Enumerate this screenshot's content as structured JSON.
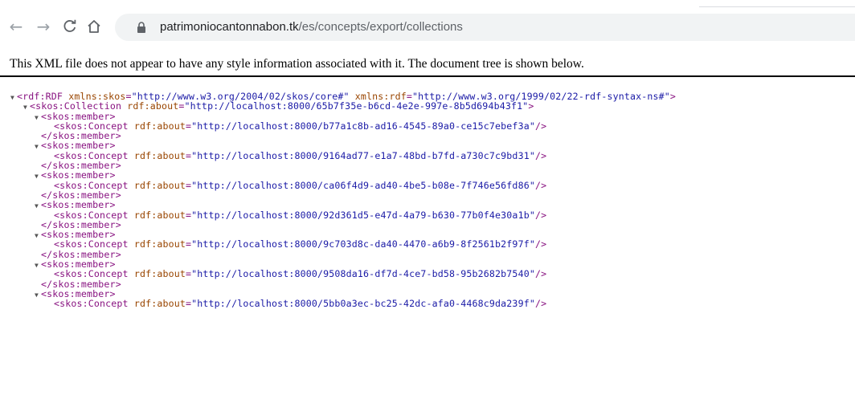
{
  "browser": {
    "url_host": "patrimoniocantonnabon.tk",
    "url_path": "/es/concepts/export/collections"
  },
  "notice": "This XML file does not appear to have any style information associated with it. The document tree is shown below.",
  "xml": {
    "root_open": "<rdf:RDF",
    "root_attr1_name": "xmlns:skos",
    "root_attr1_value": "\"http://www.w3.org/2004/02/skos/core#\"",
    "root_attr2_name": "xmlns:rdf",
    "root_attr2_value": "\"http://www.w3.org/1999/02/22-rdf-syntax-ns#\"",
    "root_close": ">",
    "collection_open": "<skos:Collection",
    "collection_attr": "rdf:about",
    "collection_value": "\"http://localhost:8000/65b7f35e-b6cd-4e2e-997e-8b5d694b43f1\"",
    "member_open": "<skos:member>",
    "member_close": "</skos:member>",
    "concept_open": "<skos:Concept",
    "concept_attr": "rdf:about",
    "members": [
      "\"http://localhost:8000/b77a1c8b-ad16-4545-89a0-ce15c7ebef3a\"",
      "\"http://localhost:8000/9164ad77-e1a7-48bd-b7fd-a730c7c9bd31\"",
      "\"http://localhost:8000/ca06f4d9-ad40-4be5-b08e-7f746e56fd86\"",
      "\"http://localhost:8000/92d361d5-e47d-4a79-b630-77b0f4e30a1b\"",
      "\"http://localhost:8000/9c703d8c-da40-4470-a6b9-8f2561b2f97f\"",
      "\"http://localhost:8000/9508da16-df7d-4ce7-bd58-95b2682b7540\"",
      "\"http://localhost:8000/5bb0a3ec-bc25-42dc-afa0-4468c9da239f\""
    ]
  },
  "icons": {
    "back": "←",
    "forward": "→",
    "reload": "C",
    "home": "⌂",
    "lock": "lock-icon",
    "triangle": "▼"
  }
}
